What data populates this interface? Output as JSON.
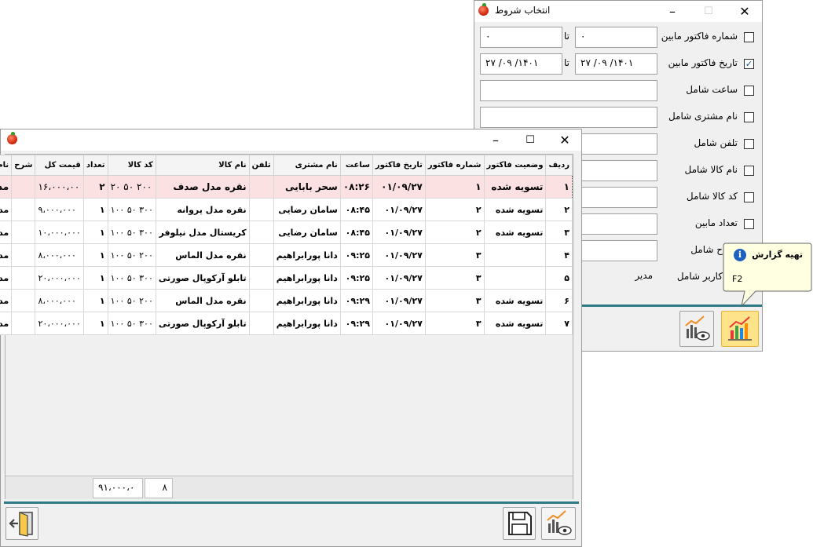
{
  "filter_window": {
    "title": "انتخاب شروط",
    "rows": [
      {
        "label": "شماره فاکتور مابین",
        "checked": false,
        "from": "۰",
        "to_label": "تا",
        "to": "۰"
      },
      {
        "label": "تاریخ فاکتور مابین",
        "checked": true,
        "from": "۲۷ /۰۹ /۱۴۰۱",
        "to_label": "تا",
        "to": "۲۷ /۰۹ /۱۴۰۱"
      },
      {
        "label": "ساعت شامل",
        "checked": false,
        "value": ""
      },
      {
        "label": "نام مشتری شامل",
        "checked": false,
        "value": ""
      },
      {
        "label": "تلفن شامل",
        "checked": false,
        "value": ""
      },
      {
        "label": "نام کالا شامل",
        "checked": false,
        "value": ""
      },
      {
        "label": "کد کالا شامل",
        "checked": false,
        "value": ""
      },
      {
        "label": "تعداد مابین",
        "checked": false,
        "value": ""
      },
      {
        "label": "ح شامل",
        "checked": false,
        "value": ""
      },
      {
        "label": "کاربر شامل",
        "checked": false,
        "value": "مدیر"
      }
    ],
    "icons": {
      "report": "chart-report-icon",
      "preview": "chart-preview-icon"
    }
  },
  "tooltip": {
    "title": "تهیه گزارش",
    "shortcut": "F2",
    "icon": "info-icon"
  },
  "main_window": {
    "columns": [
      "ردیف",
      "وضعیت فاکتور",
      "شماره فاکتور",
      "تاریخ فاکتور",
      "ساعت",
      "نام مشتری",
      "تلفن",
      "نام کالا",
      "کد کالا",
      "تعداد",
      "قیمت کل",
      "شرح",
      "نام کاربر"
    ],
    "rows": [
      [
        "۱",
        "تسویه شده",
        "۱",
        "۰۱/۰۹/۲۷",
        "۰۸:۲۶",
        "سحر بابایی",
        "",
        "نقره مدل صدف",
        "۲۰۰ ۵۰ ۲۰",
        "۲",
        "۱۶،۰۰۰،۰۰",
        "",
        "مدیر"
      ],
      [
        "۲",
        "تسویه شده",
        "۲",
        "۰۱/۰۹/۲۷",
        "۰۸:۴۵",
        "سامان رضایی",
        "",
        "نقره مدل پروانه",
        "۳۰۰ ۵۰ ۱۰۰",
        "۱",
        "۹،۰۰۰،۰۰۰",
        "",
        "مدیر"
      ],
      [
        "۳",
        "تسویه شده",
        "۲",
        "۰۱/۰۹/۲۷",
        "۰۸:۴۵",
        "سامان رضایی",
        "",
        "کریستال مدل نیلوفر",
        "۳۰۰ ۵۰ ۱۰۰",
        "۱",
        "۱۰،۰۰۰،۰۰۰",
        "",
        "مدیر"
      ],
      [
        "۴",
        "",
        "۳",
        "۰۱/۰۹/۲۷",
        "۰۹:۲۵",
        "دانا پورابراهیم",
        "",
        "نقره مدل الماس",
        "۲۰۰ ۵۰ ۱۰۰",
        "۱",
        "۸،۰۰۰،۰۰۰",
        "",
        "مدیر"
      ],
      [
        "۵",
        "",
        "۳",
        "۰۱/۰۹/۲۷",
        "۰۹:۲۵",
        "دانا پورابراهیم",
        "",
        "تابلو آرکوپال صورتی",
        "۳۰۰ ۵۰ ۱۰۰",
        "۱",
        "۲۰،۰۰۰،۰۰۰",
        "",
        "مدیر"
      ],
      [
        "۶",
        "تسویه شده",
        "۳",
        "۰۱/۰۹/۲۷",
        "۰۹:۲۹",
        "دانا پورابراهیم",
        "",
        "نقره مدل الماس",
        "۲۰۰ ۵۰ ۱۰۰",
        "۱",
        "۸،۰۰۰،۰۰۰",
        "",
        "مدیر"
      ],
      [
        "۷",
        "تسویه شده",
        "۳",
        "۰۱/۰۹/۲۷",
        "۰۹:۲۹",
        "دانا پورابراهیم",
        "",
        "تابلو آرکوپال صورتی",
        "۳۰۰ ۵۰ ۱۰۰",
        "۱",
        "۲۰،۰۰۰،۰۰۰",
        "",
        "مدیر"
      ]
    ],
    "footer": {
      "total_count": "۸",
      "total_price": "۹۱،۰۰۰،۰"
    },
    "icons": {
      "exit": "exit-door-icon",
      "save": "save-disk-icon",
      "preview": "chart-preview-icon"
    }
  }
}
